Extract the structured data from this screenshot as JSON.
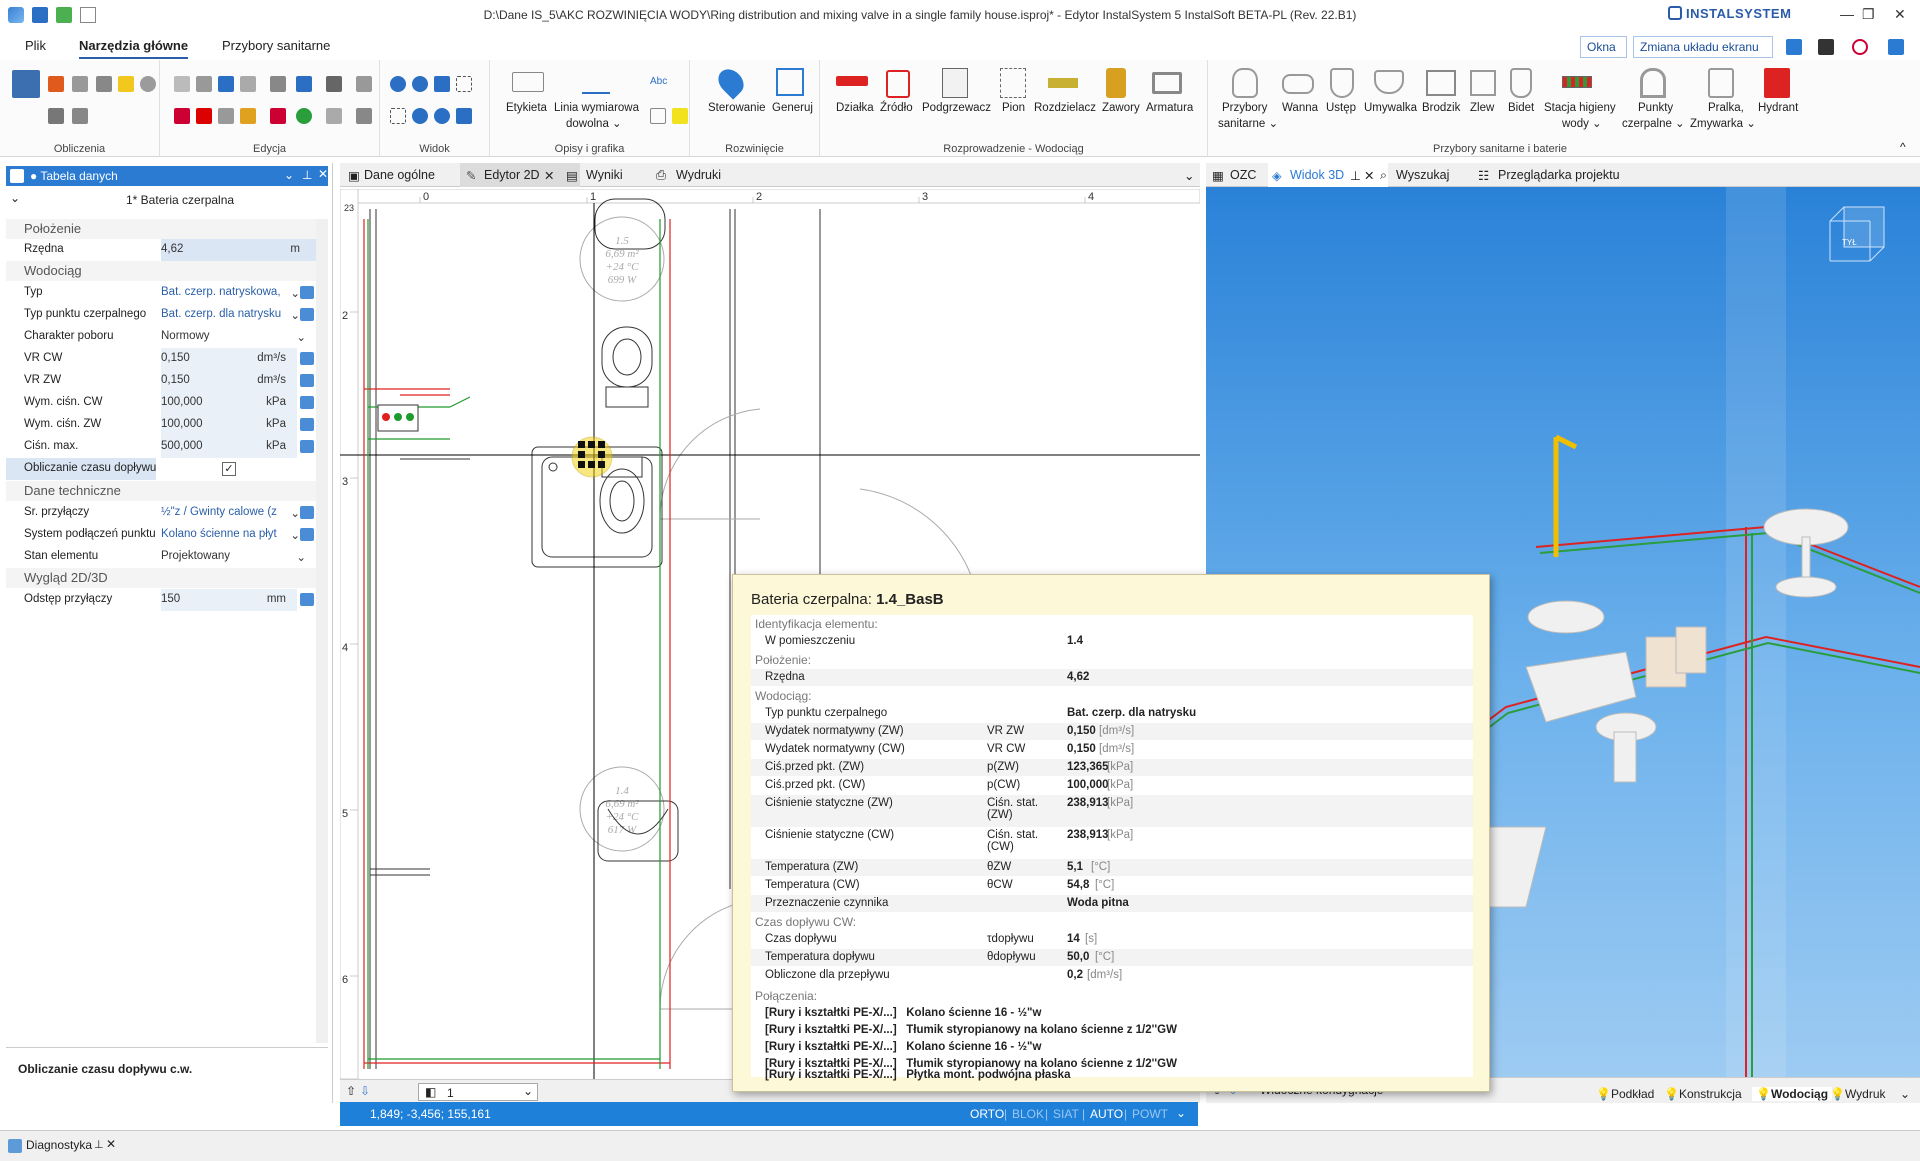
{
  "titlebar": {
    "title": "D:\\Dane IS_5\\AKC ROZWINIĘCIA WODY\\Ring distribution and mixing valve in a single family house.isproj* - Edytor InstalSystem 5 InstalSoft BETA-PL (Rev. 22.B1)",
    "brand": "INSTALSYSTEM",
    "minimize": "—",
    "maximize": "❐",
    "close": "✕"
  },
  "menu": {
    "tabs": [
      "Plik",
      "Narzędzia główne",
      "Przybory sanitarne"
    ],
    "active": "Narzędzia główne",
    "okna": "Okna ⌄",
    "zmiana": "Zmiana układu ekranu ⌄"
  },
  "ribbon": {
    "groups": {
      "obliczenia": "Obliczenia",
      "edycja": "Edycja",
      "widok": "Widok",
      "opisy": "Opisy i grafika",
      "rozwiniecie": "Rozwinięcie",
      "rozprowadzenie": "Rozprowadzenie - Wodociąg",
      "przybory": "Przybory sanitarne i baterie"
    },
    "buttons": {
      "etykieta": "Etykieta",
      "linia1": "Linia wymiarowa",
      "linia2": "dowolna ⌄",
      "sterowanie": "Sterowanie",
      "generuj": "Generuj",
      "dzialka": "Działka",
      "zrodlo": "Źródło",
      "podgrzewacz": "Podgrzewacz",
      "pion": "Pion",
      "rozdzielacz": "Rozdzielacz",
      "zawory": "Zawory",
      "armatura": "Armatura",
      "przybory1": "Przybory",
      "przybory2": "sanitarne ⌄",
      "wanna": "Wanna",
      "ustep": "Ustęp",
      "umywalka": "Umywalka",
      "brodzik": "Brodzik",
      "zlew": "Zlew",
      "bidet": "Bidet",
      "stacja1": "Stacja higieny",
      "stacja2": "wody ⌄",
      "punkty1": "Punkty",
      "punkty2": "czerpalne ⌄",
      "pralka1": "Pralka,",
      "pralka2": "Zmywarka ⌄",
      "hydrant": "Hydrant",
      "abc": "Abc"
    }
  },
  "leftpanel": {
    "header": "Tabela danych",
    "element": "1* Bateria czerpalna",
    "sections": {
      "polozenie": "Położenie",
      "wodociag": "Wodociąg",
      "dane": "Dane techniczne",
      "wyglad": "Wygląd 2D/3D"
    },
    "rows": {
      "rzedna": {
        "label": "Rzędna",
        "value": "4,62",
        "unit": "m"
      },
      "typ": {
        "label": "Typ",
        "value": "Bat. czerp. natryskowa,"
      },
      "typ_punktu": {
        "label": "Typ punktu czerpalnego",
        "value": "Bat. czerp. dla natrysku"
      },
      "charakter": {
        "label": "Charakter poboru",
        "value": "Normowy"
      },
      "vr_cw": {
        "label": "VR CW",
        "value": "0,150",
        "unit": "dm³/s"
      },
      "vr_zw": {
        "label": "VR ZW",
        "value": "0,150",
        "unit": "dm³/s"
      },
      "wym_cw": {
        "label": "Wym. ciśn. CW",
        "value": "100,000",
        "unit": "kPa"
      },
      "wym_zw": {
        "label": "Wym. ciśn. ZW",
        "value": "100,000",
        "unit": "kPa"
      },
      "cisn_max": {
        "label": "Ciśn. max.",
        "value": "500,000",
        "unit": "kPa"
      },
      "obliczanie": {
        "label": "Obliczanie czasu dopływu"
      },
      "sr_przylaczy": {
        "label": "Śr. przyłączy",
        "value": "½\"z / Gwinty calowe (z"
      },
      "system": {
        "label": "System podłączeń punktu",
        "value": "Kolano ścienne na płyt"
      },
      "stan": {
        "label": "Stan elementu",
        "value": "Projektowany"
      },
      "odstep": {
        "label": "Odstęp przyłączy",
        "value": "150",
        "unit": "mm"
      }
    },
    "footer": "Obliczanie czasu dopływu c.w."
  },
  "editor": {
    "tabs": [
      "Dane ogólne",
      "Edytor 2D",
      "Wyniki",
      "Wydruki"
    ],
    "ruler_x": [
      "0",
      "1",
      "2",
      "3",
      "4"
    ],
    "ruler_y": [
      "2",
      "3",
      "4",
      "5",
      "6"
    ],
    "ruler_corner": "23",
    "room1": [
      "1.5",
      "6,69 m²",
      "+24 °C",
      "699 W"
    ],
    "room2": [
      "1.4",
      "6,69 m²",
      "+24 °C",
      "617 W"
    ],
    "level": "1",
    "coords": "1,849; -3,456; 155,161",
    "modes": [
      "ORTO",
      "BLOK",
      "SIAT",
      "AUTO",
      "POWT"
    ],
    "subtabs": [
      "Podkład",
      "Konstrukcja",
      "Wodociąg",
      "Wydruk"
    ]
  },
  "tooltip": {
    "title_prefix": "Bateria czerpalna: ",
    "title_name": "1.4_BasB",
    "sections": {
      "ident": "Identyfikacja elementu:",
      "polozenie": "Położenie:",
      "wodociag": "Wodociąg:",
      "czas": "Czas dopływu CW:",
      "polaczenia": "Połączenia:"
    },
    "rows": [
      {
        "label": "W pomieszczeniu",
        "sym": "",
        "value": "1.4",
        "unit": ""
      },
      {
        "label": "Rzędna",
        "sym": "",
        "value": "4,62",
        "unit": ""
      },
      {
        "label": "Typ punktu czerpalnego",
        "sym": "",
        "value": "Bat. czerp. dla natrysku",
        "unit": ""
      },
      {
        "label": "Wydatek normatywny (ZW)",
        "sym": "VR ZW",
        "value": "0,150",
        "unit": "[dm³/s]"
      },
      {
        "label": "Wydatek normatywny (CW)",
        "sym": "VR CW",
        "value": "0,150",
        "unit": "[dm³/s]"
      },
      {
        "label": "Ciś.przed pkt. (ZW)",
        "sym": "p(ZW)",
        "value": "123,365",
        "unit": "[kPa]"
      },
      {
        "label": "Ciś.przed pkt. (CW)",
        "sym": "p(CW)",
        "value": "100,000",
        "unit": "[kPa]"
      },
      {
        "label": "Ciśnienie statyczne (ZW)",
        "sym": "Ciśn. stat. (ZW)",
        "value": "238,913",
        "unit": "[kPa]"
      },
      {
        "label": "Ciśnienie statyczne (CW)",
        "sym": "Ciśn. stat. (CW)",
        "value": "238,913",
        "unit": "[kPa]"
      },
      {
        "label": "Temperatura (ZW)",
        "sym": "θZW",
        "value": "5,1",
        "unit": "[°C]"
      },
      {
        "label": "Temperatura (CW)",
        "sym": "θCW",
        "value": "54,8",
        "unit": "[°C]"
      },
      {
        "label": "Przeznaczenie czynnika",
        "sym": "",
        "value": "Woda pitna",
        "unit": ""
      },
      {
        "label": "Czas dopływu",
        "sym": "τdopływu",
        "value": "14",
        "unit": "[s]"
      },
      {
        "label": "Temperatura dopływu",
        "sym": "θdopływu",
        "value": "50,0",
        "unit": "[°C]"
      },
      {
        "label": "Obliczone dla przepływu",
        "sym": "",
        "value": "0,2",
        "unit": "[dm³/s]"
      }
    ],
    "connections": [
      {
        "a": "[Rury i kształtki PE-X/...]",
        "b": "Kolano ścienne 16 - ½\"w"
      },
      {
        "a": "[Rury i kształtki PE-X/...]",
        "b": "Tłumik styropianowy na kolano ścienne z 1/2''GW"
      },
      {
        "a": "[Rury i kształtki PE-X/...]",
        "b": "Kolano ścienne 16 - ½\"w"
      },
      {
        "a": "[Rury i kształtki PE-X/...]",
        "b": "Tłumik styropianowy na kolano ścienne z 1/2''GW"
      },
      {
        "a": "[Rury i kształtki PE-X/...]",
        "b": "Płytka mont. podwójna płaska"
      }
    ]
  },
  "view3d": {
    "tabs": [
      "OZC",
      "Widok 3D",
      "Wyszukaj",
      "Przeglądarka projektu"
    ],
    "cube": "TYŁ",
    "layer": "Widoczne kondygnacje",
    "subtabs": [
      "Podkład",
      "Konstrukcja",
      "Wodociąg",
      "Wydruk"
    ]
  },
  "bottom": {
    "diagnostyka": "Diagnostyka"
  },
  "colors": {
    "accent": "#2b7bd3",
    "pipe_cold": "#1e9a2e",
    "pipe_hot": "#e02020",
    "tooltip_bg": "#fdf8d8",
    "status_blue": "#1e80d8"
  }
}
